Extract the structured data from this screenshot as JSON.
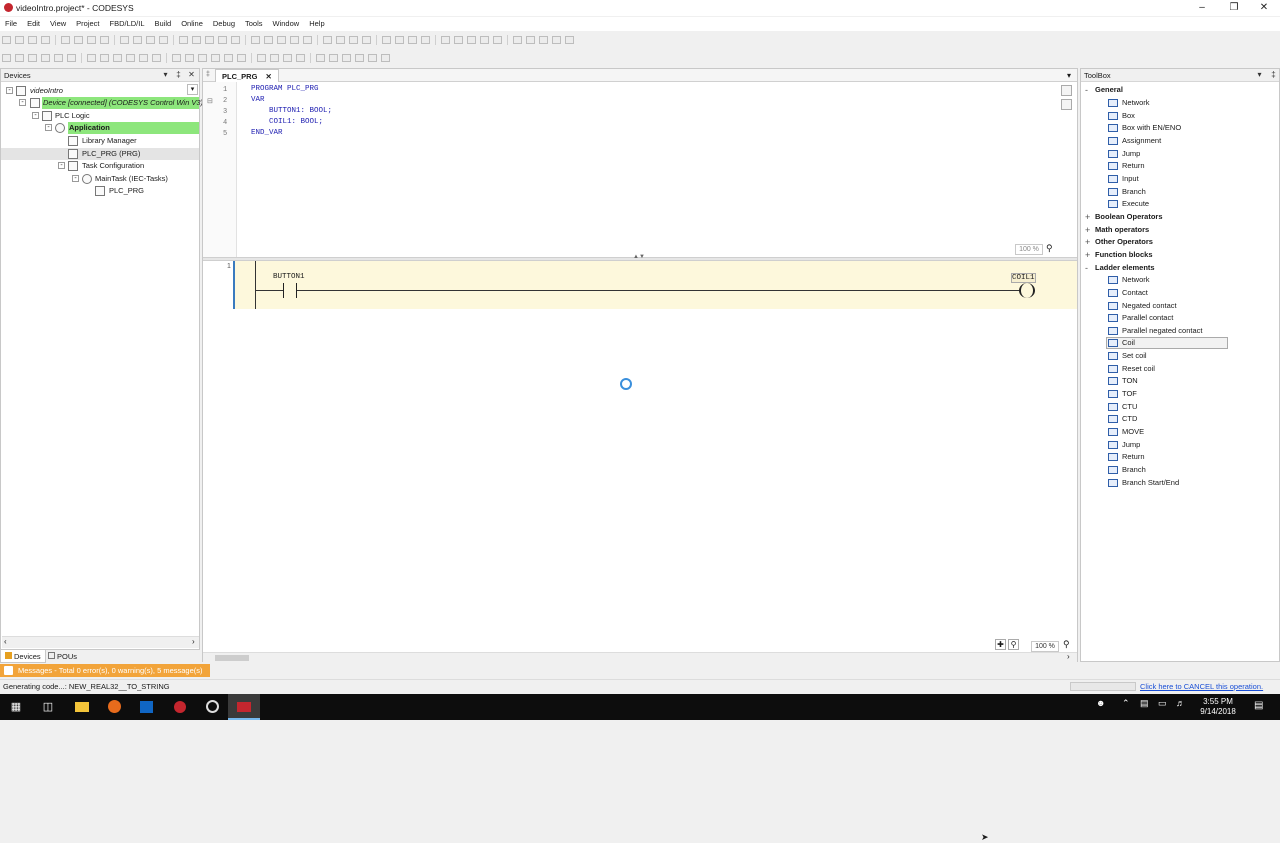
{
  "window": {
    "title": "videoIntro.project* - CODESYS"
  },
  "menu": [
    "File",
    "Edit",
    "View",
    "Project",
    "FBD/LD/IL",
    "Build",
    "Online",
    "Debug",
    "Tools",
    "Window",
    "Help"
  ],
  "devices_panel": {
    "title": "Devices",
    "tree": [
      {
        "label": "videoIntro",
        "icon": "project-icon"
      },
      {
        "label": "Device [connected] (CODESYS Control Win V3)",
        "icon": "device-icon"
      },
      {
        "label": "PLC Logic",
        "icon": "plc-logic-icon"
      },
      {
        "label": "Application",
        "icon": "application-icon"
      },
      {
        "label": "Library Manager",
        "icon": "library-icon"
      },
      {
        "label": "PLC_PRG (PRG)",
        "icon": "pou-icon"
      },
      {
        "label": "Task Configuration",
        "icon": "task-config-icon"
      },
      {
        "label": "MainTask (IEC-Tasks)",
        "icon": "task-icon"
      },
      {
        "label": "PLC_PRG",
        "icon": "program-call-icon"
      }
    ]
  },
  "bottom_tabs": [
    "Devices",
    "POUs"
  ],
  "editor": {
    "tab_label": "PLC_PRG",
    "declaration_lines": [
      "PROGRAM PLC_PRG",
      "VAR",
      "    BUTTON1: BOOL;",
      "    COIL1: BOOL;",
      "END_VAR"
    ],
    "line_numbers": [
      "1",
      "2",
      "3",
      "4",
      "5"
    ],
    "decl_zoom": "100 %",
    "network_number": "1",
    "contact_label": "BUTTON1",
    "coil_label": "COIL1",
    "ladder_zoom": "100 %"
  },
  "toolbox": {
    "title": "ToolBox",
    "categories": [
      {
        "name": "General",
        "expanded": true,
        "items": [
          "Network",
          "Box",
          "Box with EN/ENO",
          "Assignment",
          "Jump",
          "Return",
          "Input",
          "Branch",
          "Execute"
        ]
      },
      {
        "name": "Boolean Operators",
        "expanded": false,
        "items": []
      },
      {
        "name": "Math operators",
        "expanded": false,
        "items": []
      },
      {
        "name": "Other Operators",
        "expanded": false,
        "items": []
      },
      {
        "name": "Function blocks",
        "expanded": false,
        "items": []
      },
      {
        "name": "Ladder elements",
        "expanded": true,
        "items": [
          "Network",
          "Contact",
          "Negated contact",
          "Parallel contact",
          "Parallel negated contact",
          "Coil",
          "Set coil",
          "Reset coil",
          "TON",
          "TOF",
          "CTU",
          "CTD",
          "MOVE",
          "Jump",
          "Return",
          "Branch",
          "Branch Start/End"
        ]
      }
    ],
    "selected_item": "Coil"
  },
  "messages_bar": "Messages - Total 0 error(s), 0 warning(s), 5 message(s)",
  "status": {
    "text": "Generating code...: NEW_REAL32__TO_STRING",
    "cancel_link": "Click here to CANCEL this operation."
  },
  "taskbar": {
    "time": "3:55 PM",
    "date": "9/14/2018"
  },
  "colors": {
    "accent": "#3a7bbf",
    "network_bg": "#fdf8dc",
    "selection_green": "#8de67c",
    "messages_orange": "#f2a43a"
  }
}
